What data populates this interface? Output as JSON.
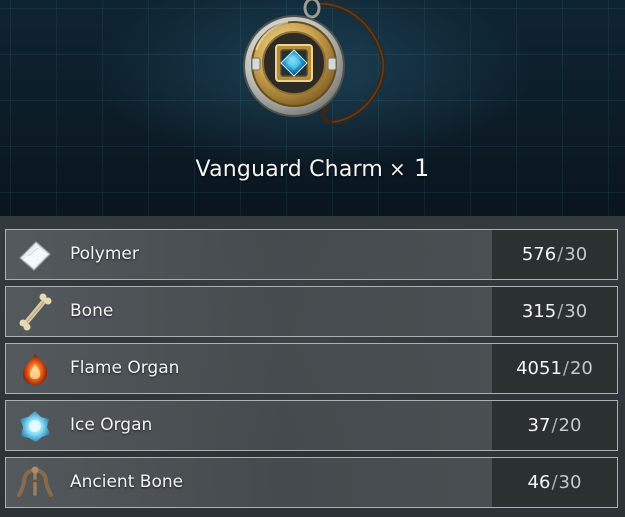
{
  "item": {
    "name": "Vanguard Charm",
    "times_symbol": "×",
    "quantity": "1",
    "icon": "vanguard-charm-icon"
  },
  "materials": [
    {
      "name": "Polymer",
      "have": "576",
      "sep": "/",
      "need": "30",
      "icon": "polymer-icon"
    },
    {
      "name": "Bone",
      "have": "315",
      "sep": "/",
      "need": "30",
      "icon": "bone-icon"
    },
    {
      "name": "Flame Organ",
      "have": "4051",
      "sep": "/",
      "need": "20",
      "icon": "flame-organ-icon"
    },
    {
      "name": "Ice Organ",
      "have": "37",
      "sep": "/",
      "need": "20",
      "icon": "ice-organ-icon"
    },
    {
      "name": "Ancient Bone",
      "have": "46",
      "sep": "/",
      "need": "30",
      "icon": "ancient-bone-icon"
    }
  ],
  "colors": {
    "header_bg": "#0c1c27",
    "row_bg": "#50575a",
    "row_border": "#a9b1b4",
    "text": "#f2f4f4"
  }
}
